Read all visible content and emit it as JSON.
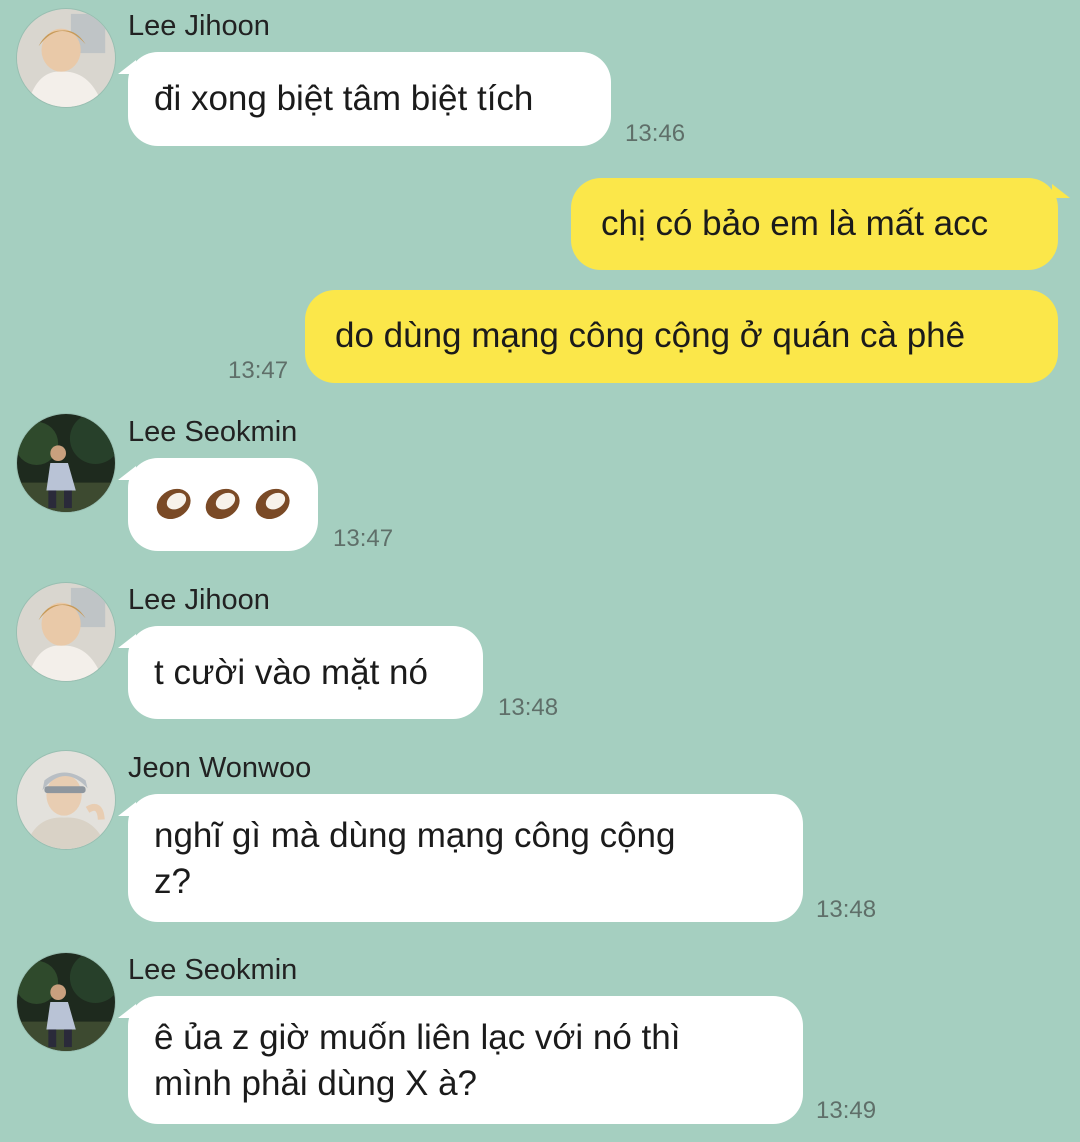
{
  "messages": [
    {
      "sender": "Lee Jihoon",
      "text": "đi xong biệt tâm biệt tích",
      "time": "13:46"
    },
    {
      "text": "chị có bảo em là mất acc"
    },
    {
      "text": "do dùng mạng công cộng ở quán cà phê",
      "time": "13:47"
    },
    {
      "sender": "Lee Seokmin",
      "emoji": "coconut-emoji x3",
      "time": "13:47"
    },
    {
      "sender": "Lee Jihoon",
      "text": "t cười vào mặt nó",
      "time": "13:48"
    },
    {
      "sender": "Jeon Wonwoo",
      "line1": "nghĩ gì mà dùng mạng công cộng",
      "line2": "z?",
      "time": "13:48"
    },
    {
      "sender": "Lee Seokmin",
      "line1": "ê ủa z giờ muốn liên lạc với nó thì",
      "line2": "mình phải dùng X à?",
      "time": "13:49"
    }
  ],
  "colors": {
    "background": "#a5cfc0",
    "incoming": "#ffffff",
    "outgoing": "#fbe74a"
  }
}
